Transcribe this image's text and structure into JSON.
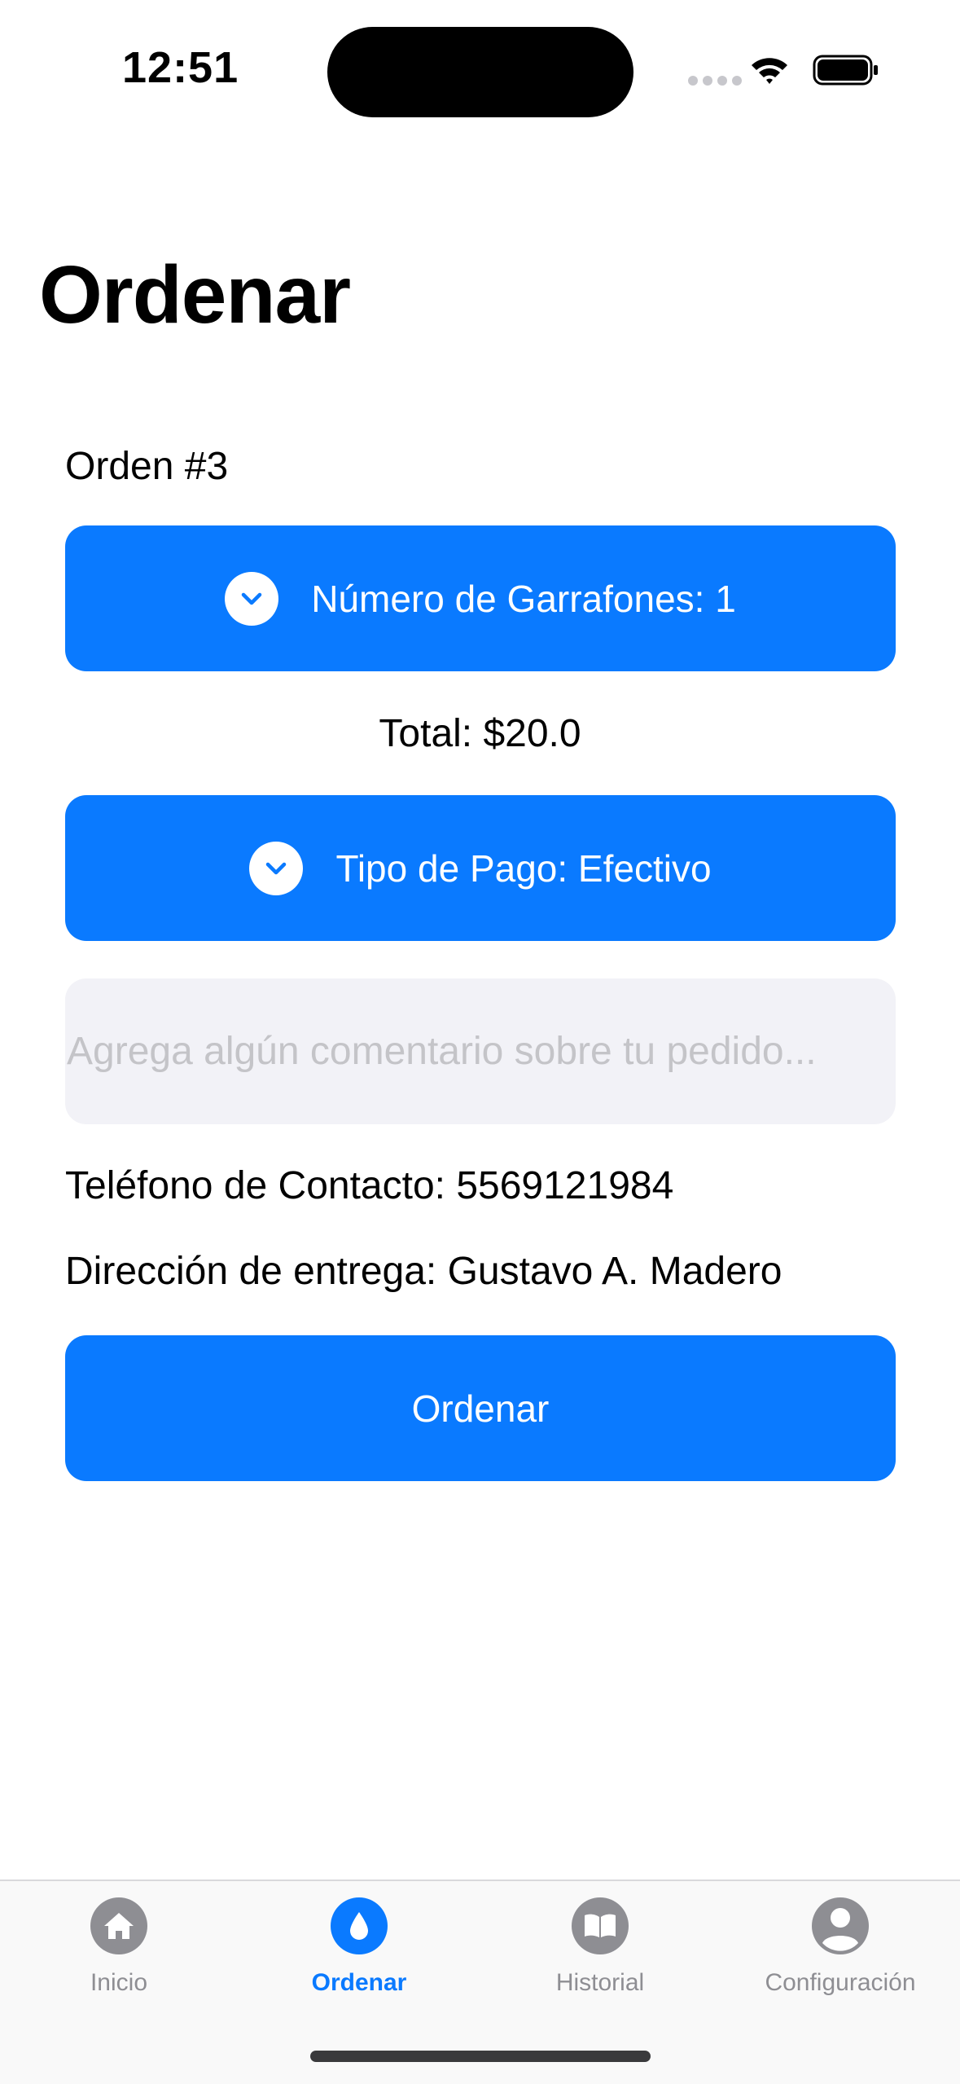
{
  "status_bar": {
    "time": "12:51",
    "icons": [
      "signal-dots-icon",
      "wifi-icon",
      "battery-icon"
    ]
  },
  "page": {
    "title": "Ordenar",
    "order_number": "Orden #3",
    "garrafones_button": "Número de Garrafones: 1",
    "total": "Total: $20.0",
    "payment_button": "Tipo de Pago: Efectivo",
    "comment_placeholder": "Agrega algún comentario sobre tu pedido...",
    "phone": "Teléfono de Contacto: 5569121984",
    "address": "Dirección de entrega: Gustavo A. Madero",
    "order_button": "Ordenar"
  },
  "tab_bar": {
    "tabs": [
      {
        "label": "Inicio",
        "icon": "house-icon",
        "active": false
      },
      {
        "label": "Ordenar",
        "icon": "drop-icon",
        "active": true
      },
      {
        "label": "Historial",
        "icon": "book-icon",
        "active": false
      },
      {
        "label": "Configuración",
        "icon": "person-icon",
        "active": false
      }
    ]
  },
  "colors": {
    "accent": "#0a7aff",
    "inactive": "#8e8e93",
    "input_background": "#f2f2f7"
  }
}
